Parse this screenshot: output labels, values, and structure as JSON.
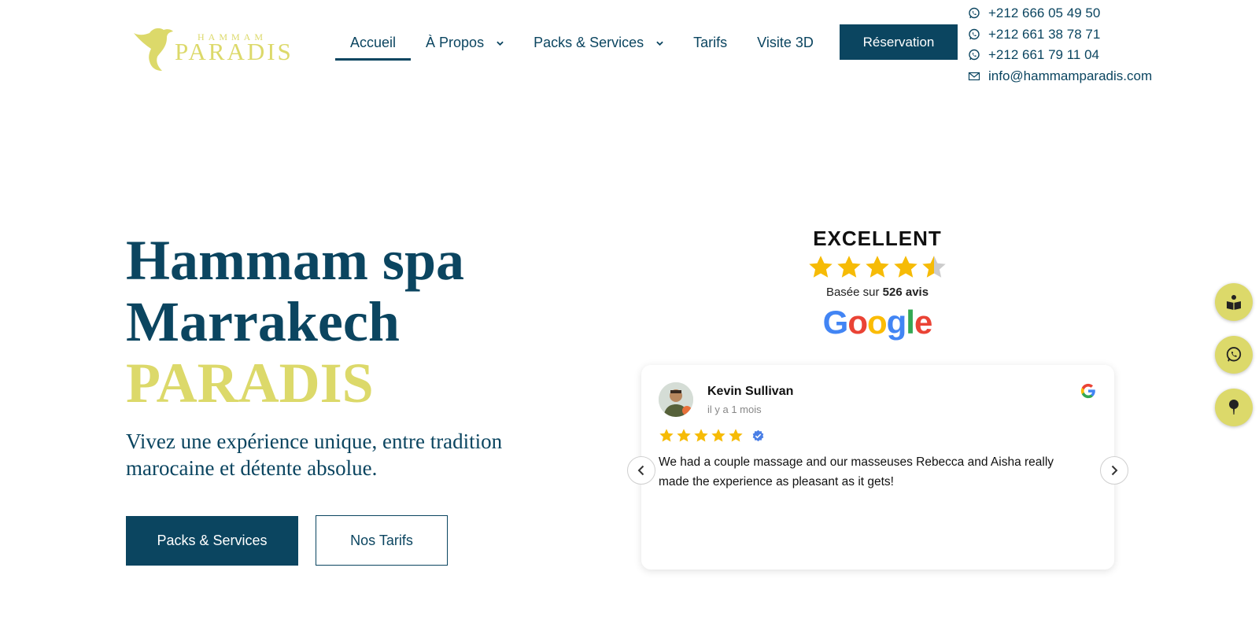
{
  "logo": {
    "small": "HAMMAM",
    "big": "PARADIS"
  },
  "nav": {
    "items": [
      {
        "label": "Accueil"
      },
      {
        "label": "À Propos"
      },
      {
        "label": "Packs & Services"
      },
      {
        "label": "Tarifs"
      },
      {
        "label": "Visite 3D"
      }
    ],
    "cta": "Réservation"
  },
  "contacts": [
    {
      "icon": "whatsapp-icon",
      "text": "+212 666 05 49 50"
    },
    {
      "icon": "whatsapp-icon",
      "text": "+212 661 38 78 71"
    },
    {
      "icon": "whatsapp-icon",
      "text": "+212 661 79 11 04"
    },
    {
      "icon": "mail-icon",
      "text": "info@hammamparadis.com"
    }
  ],
  "hero": {
    "title_line1": "Hammam spa",
    "title_line2": "Marrakech",
    "title_accent": "PARADIS",
    "subtitle": "Vivez une expérience unique, entre tradition marocaine et détente absolue.",
    "btn_primary": "Packs & Services",
    "btn_secondary": "Nos Tarifs"
  },
  "rating": {
    "title": "EXCELLENT",
    "stars": 4.5,
    "based_prefix": "Basée sur ",
    "based_count": "526 avis",
    "brand": "Google"
  },
  "review": {
    "name": "Kevin Sullivan",
    "time": "il y a 1 mois",
    "stars": 5,
    "text": "We had a couple massage and our masseuses Rebecca and Aisha really made the experience as pleasant as it gets!"
  },
  "colors": {
    "primary": "#0b4560",
    "accent": "#dcd96a",
    "star": "#f6bb06"
  }
}
